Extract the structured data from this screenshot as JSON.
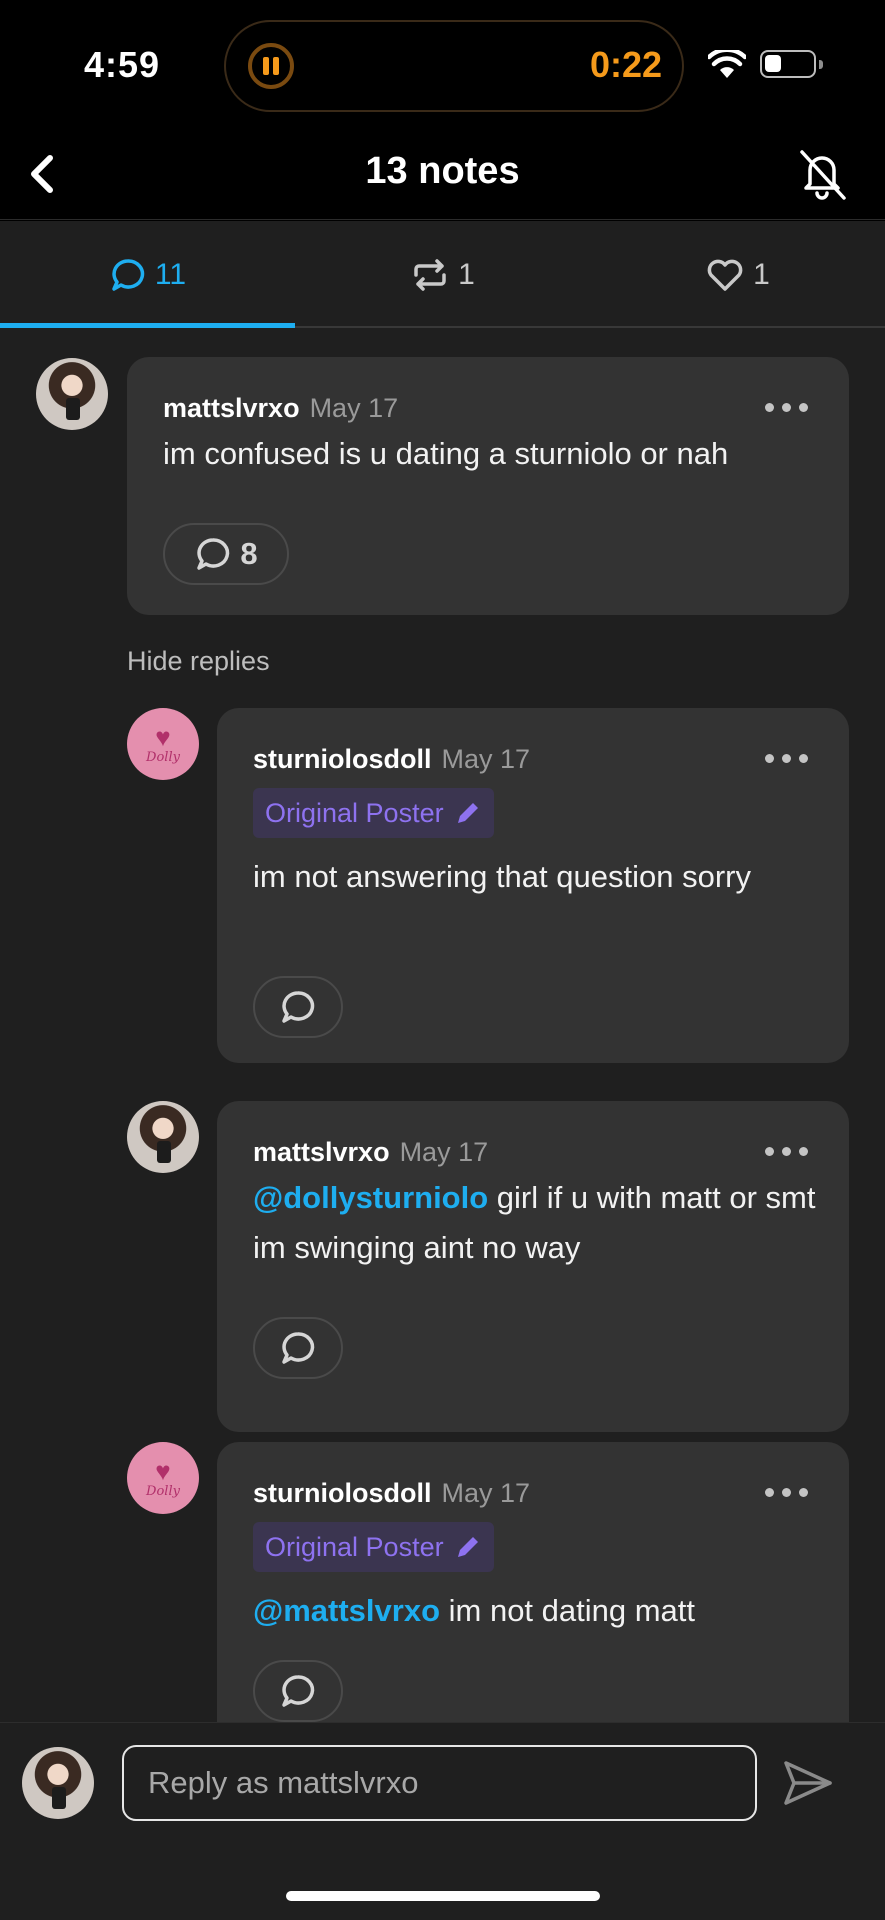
{
  "status_bar": {
    "time": "4:59",
    "timer": "0:22",
    "battery_level": 0.35
  },
  "header": {
    "title": "13 notes"
  },
  "tabs": [
    {
      "icon": "comment-icon",
      "count": "11",
      "active": true
    },
    {
      "icon": "reblog-icon",
      "count": "1",
      "active": false
    },
    {
      "icon": "heart-icon",
      "count": "1",
      "active": false
    }
  ],
  "comments": [
    {
      "username": "mattslvrxo",
      "date": "May 17",
      "text": "im confused is u dating a sturniolo or nah",
      "reply_count": "8"
    },
    {
      "username": "sturniolosdoll",
      "date": "May 17",
      "badge": "Original Poster",
      "text": "im not answering that question sorry"
    },
    {
      "username": "mattslvrxo",
      "date": "May 17",
      "mention": "@dollysturniolo",
      "text": " girl if u with matt or smt im swinging aint no way"
    },
    {
      "username": "sturniolosdoll",
      "date": "May 17",
      "badge": "Original Poster",
      "mention": "@mattslvrxo",
      "text": " im not dating matt"
    }
  ],
  "hide_replies_label": "Hide replies",
  "avatar_doll_text": "Dolly",
  "composer": {
    "placeholder": "Reply as mattslvrxo"
  },
  "colors": {
    "accent": "#1eaef0",
    "op_badge": "#8e72f0",
    "timer": "#f59a1b",
    "bubble": "#333333",
    "background": "#1f1f1f"
  }
}
